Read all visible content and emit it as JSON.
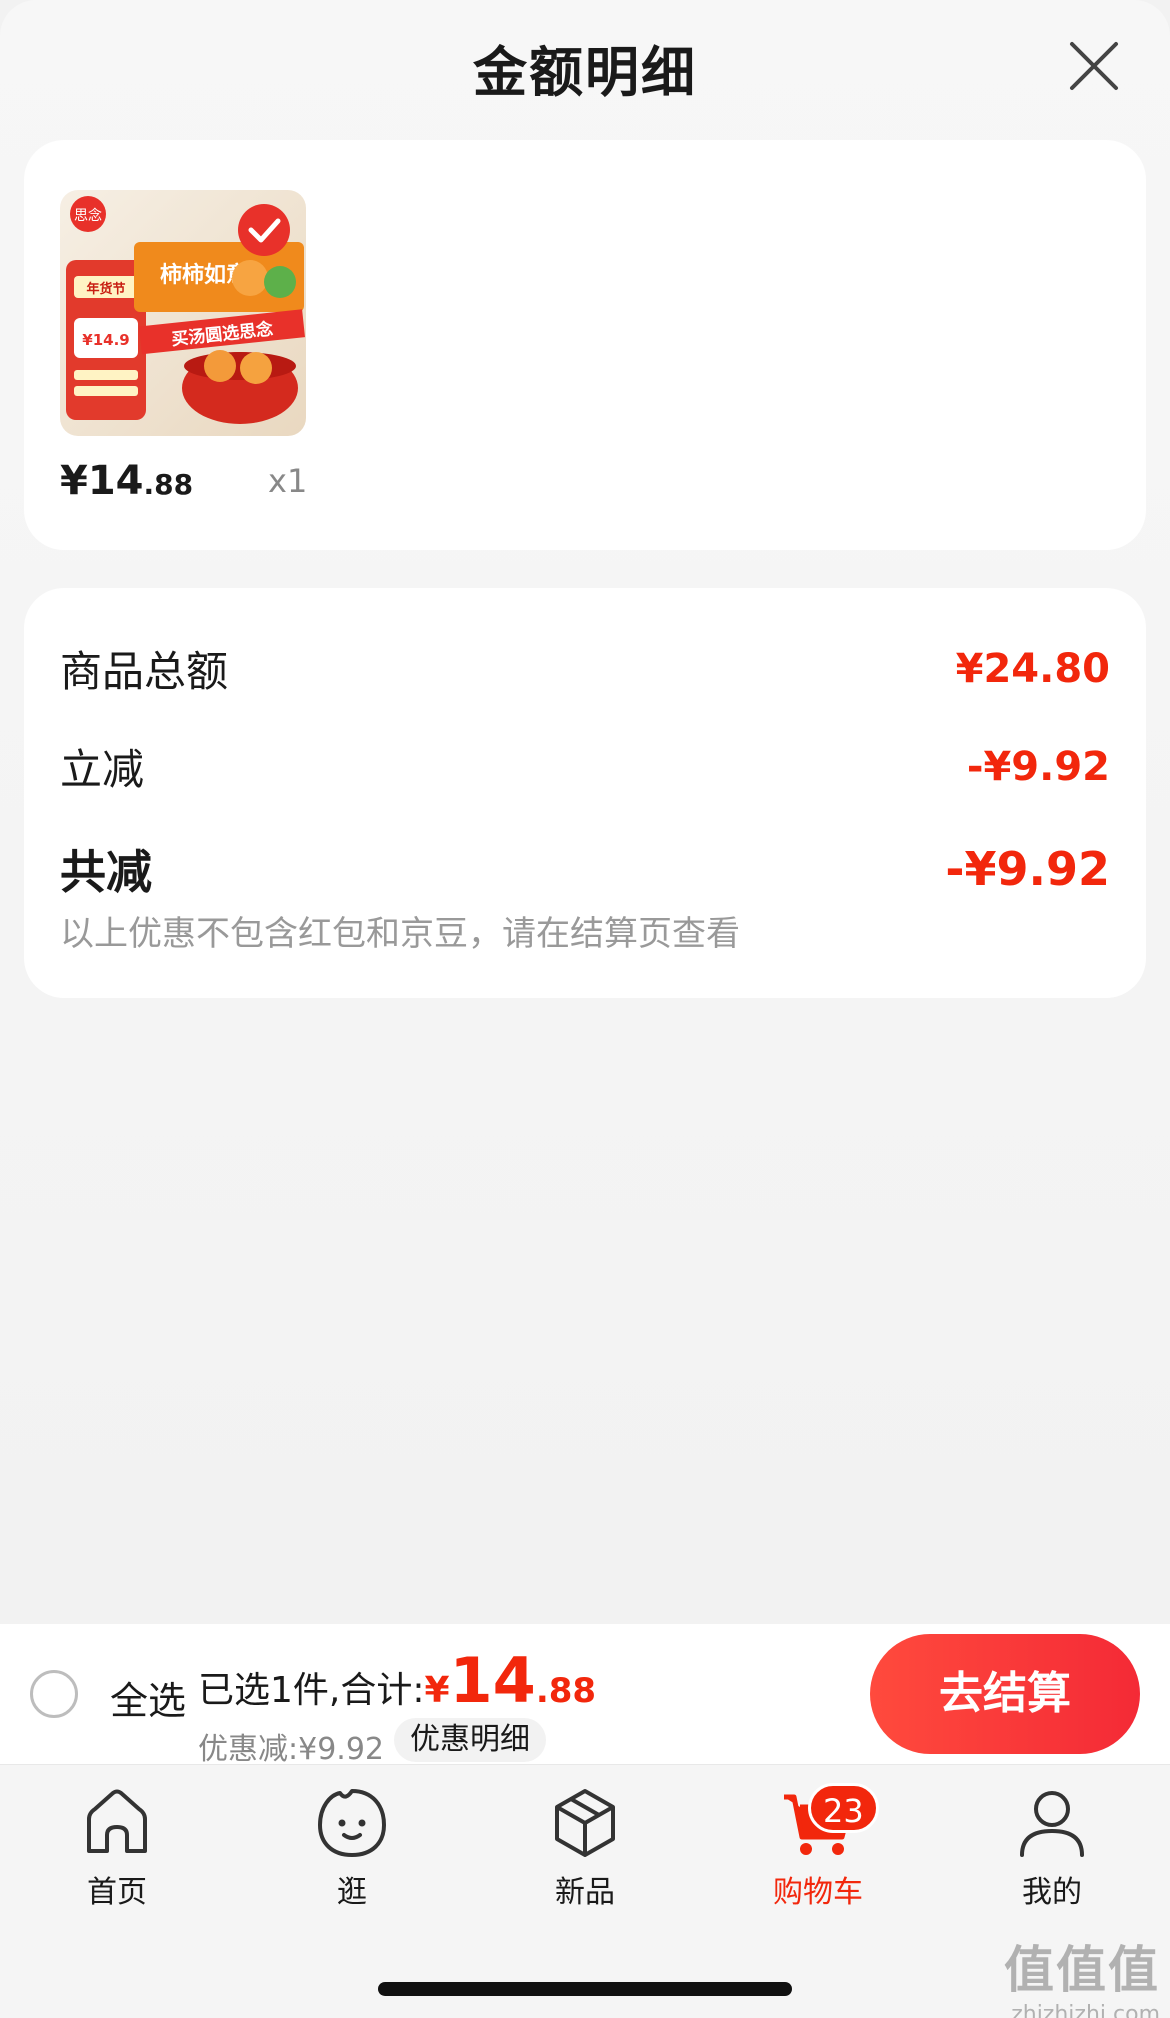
{
  "header": {
    "title": "金额明细"
  },
  "product": {
    "price_int": "¥14",
    "price_dec": ".88",
    "quantity": "x1",
    "image_texts": {
      "brand": "思念",
      "festival": "年货节",
      "product_name": "柿柿如意",
      "banner": "买汤圆选思念",
      "price_tag": "¥14.9"
    }
  },
  "summary": {
    "rows": [
      {
        "label": "商品总额",
        "value": "¥24.80"
      },
      {
        "label": "立减",
        "value": "-¥9.92"
      }
    ],
    "total": {
      "label": "共减",
      "value": "-¥9.92"
    },
    "note": "以上优惠不包含红包和京豆，请在结算页查看"
  },
  "checkout": {
    "select_all": "全选",
    "selected_text": "已选1件,合计:",
    "currency": "¥",
    "total_int": "14",
    "total_dec": ".88",
    "discount_text": "优惠减:¥9.92",
    "discount_detail": "优惠明细",
    "checkout_button": "去结算"
  },
  "tabbar": {
    "tabs": [
      {
        "label": "首页",
        "icon": "home-icon"
      },
      {
        "label": "逛",
        "icon": "explore-icon"
      },
      {
        "label": "新品",
        "icon": "new-products-icon"
      },
      {
        "label": "购物车",
        "icon": "cart-icon",
        "badge": "23"
      },
      {
        "label": "我的",
        "icon": "profile-icon"
      }
    ]
  },
  "watermark": {
    "big": "值值值",
    "small": "zhizhizhi.com"
  },
  "colors": {
    "accent": "#f2270c",
    "button": "#f42a36"
  }
}
